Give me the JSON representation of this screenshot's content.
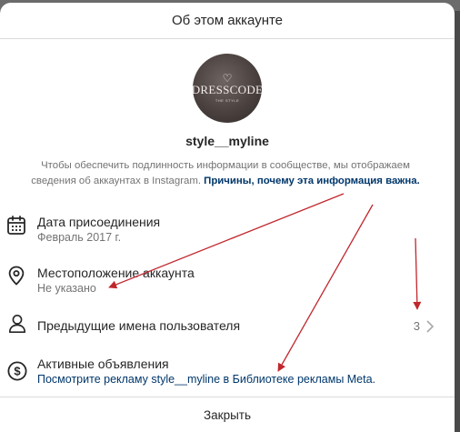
{
  "dialog": {
    "title": "Об этом аккаунте",
    "close_label": "Закрыть"
  },
  "profile": {
    "avatar_text": "DRESSCODE",
    "avatar_subtext": "THE STYLE",
    "username": "style__myline",
    "info_text": "Чтобы обеспечить подлинность информации в сообществе, мы отображаем сведения об аккаунтах в Instagram.",
    "info_link": "Причины, почему эта информация важна."
  },
  "rows": {
    "joined": {
      "title": "Дата присоединения",
      "value": "Февраль 2017 г.",
      "icon": "calendar-icon"
    },
    "location": {
      "title": "Местоположение аккаунта",
      "value": "Не указано",
      "icon": "location-pin-icon"
    },
    "usernames": {
      "title": "Предыдущие имена пользователя",
      "count": "3",
      "icon": "person-icon"
    },
    "ads": {
      "title": "Активные объявления",
      "link": "Посмотрите рекламу style__myline в Библиотеке рекламы Meta.",
      "icon": "dollar-circle-icon"
    }
  },
  "annotations": {
    "arrow_color": "#c0272d"
  }
}
